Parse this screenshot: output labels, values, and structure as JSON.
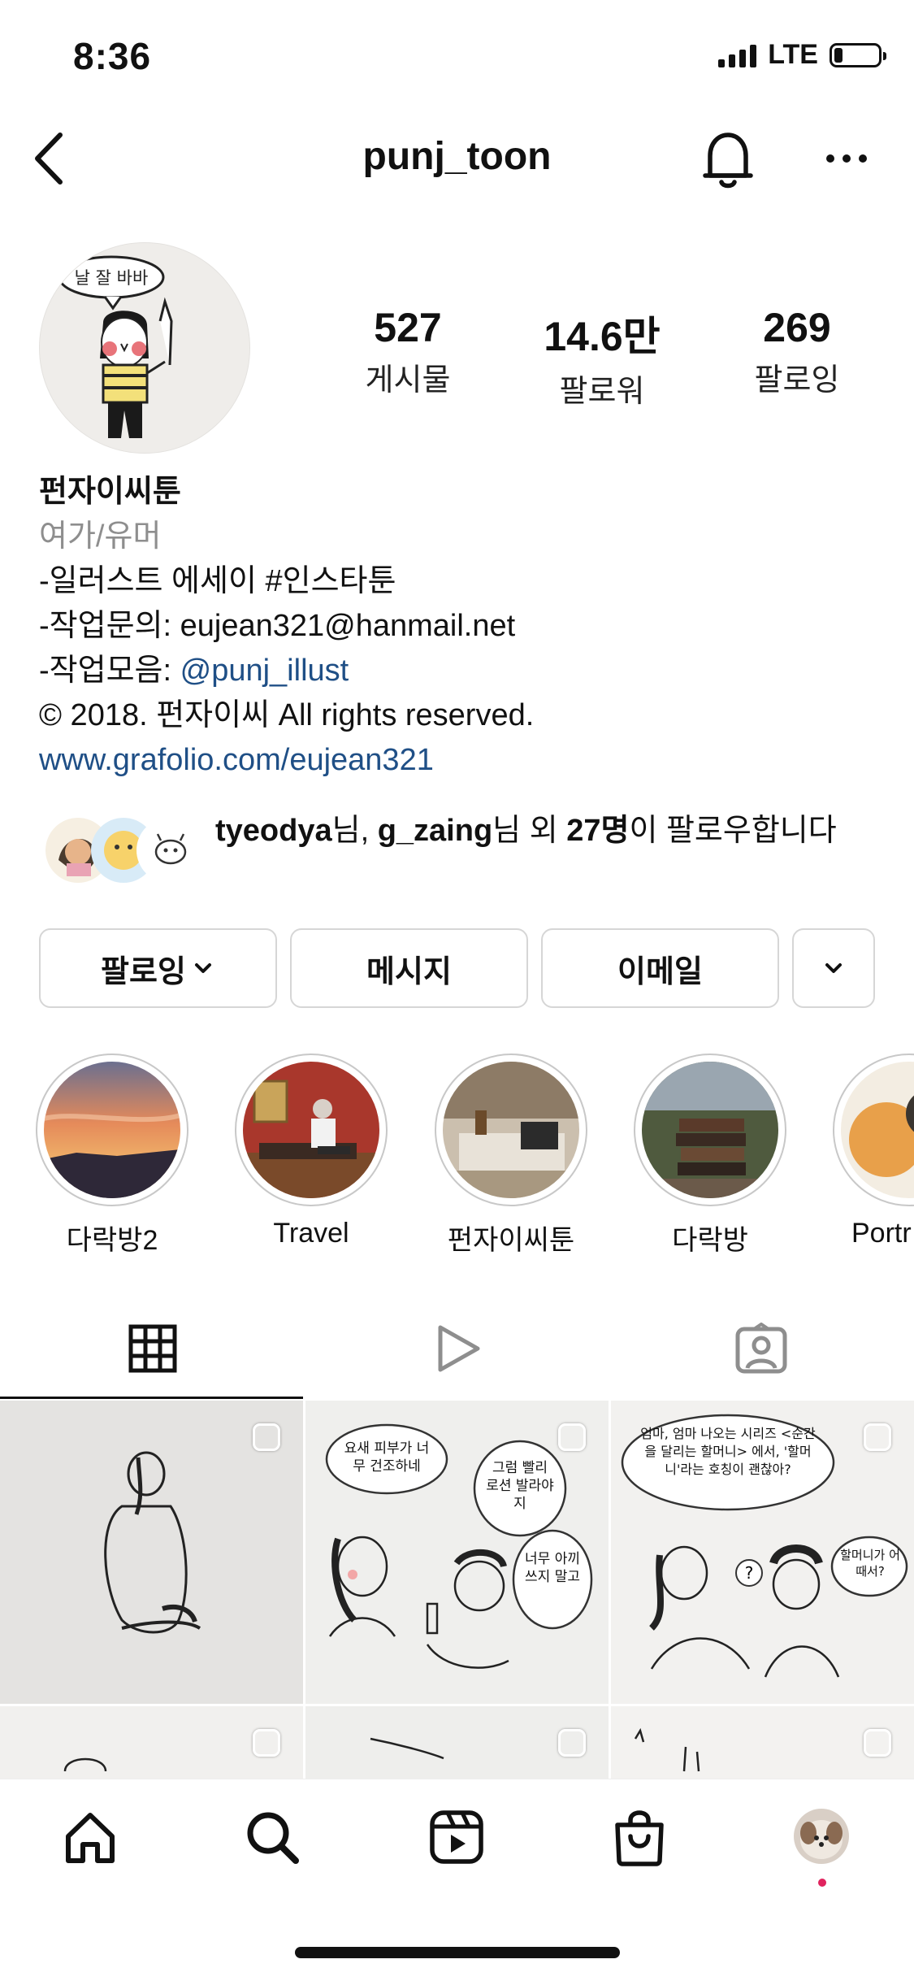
{
  "status": {
    "time": "8:36",
    "network": "LTE",
    "battery_level": 0.2
  },
  "header": {
    "username": "punj_toon"
  },
  "profile": {
    "stats": [
      {
        "value": "527",
        "label": "게시물"
      },
      {
        "value": "14.6만",
        "label": "팔로워"
      },
      {
        "value": "269",
        "label": "팔로잉"
      }
    ],
    "avatar_bubble_text": "날 잘 바바",
    "name": "펀자이씨툰",
    "category": "여가/유머",
    "bio": {
      "line1": "-일러스트 에세이 #인스타툰",
      "line2": "-작업문의: eujean321@hanmail.net",
      "line3_prefix": "-작업모음: ",
      "line3_link": "@punj_illust",
      "line4": "© 2018. 펀자이씨 All rights reserved.",
      "website": "www.grafolio.com/eujean321"
    }
  },
  "followed_by": {
    "user1": "tyeodya",
    "suffix1": "님, ",
    "user2": "g_zaing",
    "suffix2": "님 외 ",
    "count": "27명",
    "suffix3": "이 팔로우합니다"
  },
  "actions": {
    "following_label": "팔로잉",
    "message_label": "메시지",
    "email_label": "이메일"
  },
  "highlights": [
    {
      "label": "다락방2"
    },
    {
      "label": "Travel"
    },
    {
      "label": "펀자이씨툰"
    },
    {
      "label": "다락방"
    },
    {
      "label": "Portr"
    }
  ],
  "tabs": {
    "active": "grid"
  },
  "posts": {
    "p2_bubble1": "요새 피부가 너무 건조하네",
    "p2_bubble2": "그럼 빨리 로션 발라야지",
    "p2_bubble3": "너무 아끼쓰지 말고",
    "p3_bubble1": "엄마, 엄마 나오는 시리즈 <순간을 달리는 할머니> 에서, '할머니'라는 호칭이 괜찮아?",
    "p3_bubble2": "할머니가 어때서?"
  },
  "colors": {
    "link": "#1f4f86",
    "notification_dot": "#e0245e"
  }
}
